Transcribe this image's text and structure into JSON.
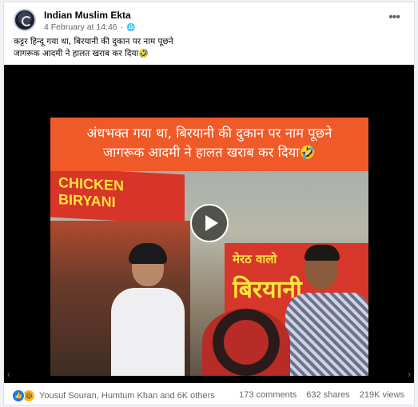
{
  "post": {
    "page_name": "Indian Muslim Ekta",
    "date": "4 February at 14:46",
    "separator": "·",
    "globe_icon": "globe-icon",
    "more_icon": "more-options-icon",
    "caption_line1": "कट्टर हिन्दू गया था, बिरयानी की दुकान पर नाम पूछने",
    "caption_line2": "जागरूक आदमी ने हालत खराब कर दिया🤣"
  },
  "video": {
    "overlay_line1": "अंधभक्त गया था, बिरयानी की दुकान पर नाम पूछने",
    "overlay_line2": "जागरूक आदमी ने हालत खराब कर दिया🤣",
    "stall_sign": "CHICKEN BIRYANI",
    "board_line1": "मेरठ वालो",
    "board_line2": "बिरयानी",
    "play_icon": "play-icon",
    "prev_icon": "chevron-left-icon",
    "next_icon": "chevron-right-icon",
    "background": "#000000",
    "overlay_color": "#f05a28"
  },
  "footer": {
    "reaction_icons": [
      "like-icon",
      "haha-icon"
    ],
    "reaction_names": "Yousuf Souran, Humtum Khan and 6K others",
    "comments": "173 comments",
    "shares": "632 shares",
    "views": "219K views",
    "like_color": "#1877f2"
  }
}
